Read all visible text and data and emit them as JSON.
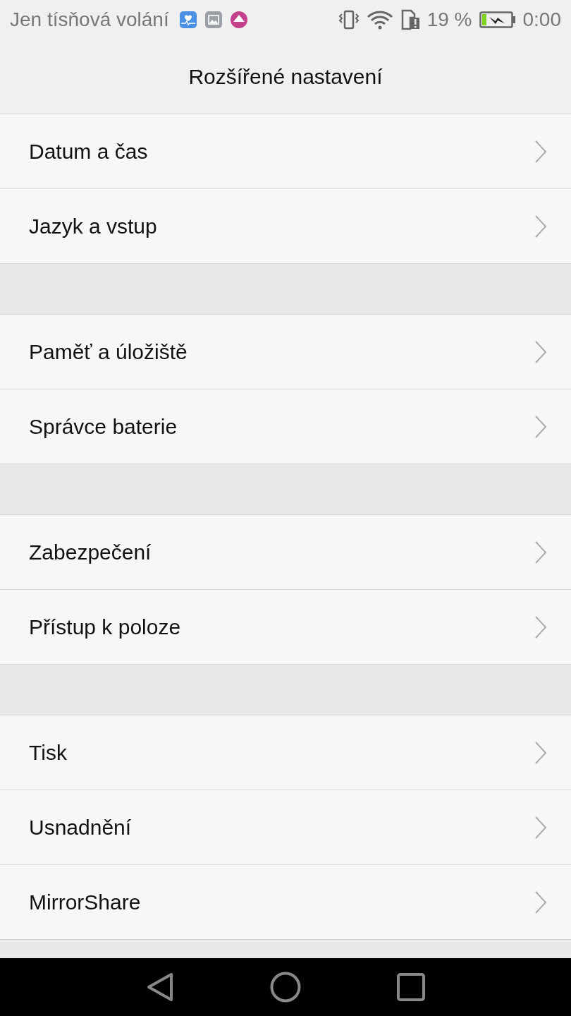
{
  "status_bar": {
    "carrier": "Jen tísňová volání",
    "battery_percent": "19 %",
    "time": "0:00"
  },
  "header": {
    "title": "Rozšířené nastavení"
  },
  "groups": [
    {
      "items": [
        {
          "label": "Datum a čas"
        },
        {
          "label": "Jazyk a vstup"
        }
      ]
    },
    {
      "items": [
        {
          "label": "Paměť a úložiště"
        },
        {
          "label": "Správce baterie"
        }
      ]
    },
    {
      "items": [
        {
          "label": "Zabezpečení"
        },
        {
          "label": "Přístup k poloze"
        }
      ]
    },
    {
      "items": [
        {
          "label": "Tisk"
        },
        {
          "label": "Usnadnění"
        },
        {
          "label": "MirrorShare"
        }
      ]
    }
  ]
}
